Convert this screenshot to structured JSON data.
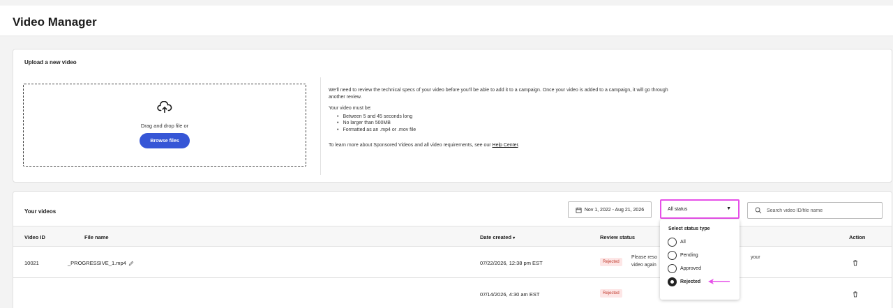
{
  "header": {
    "title": "Video Manager"
  },
  "upload": {
    "title": "Upload a new video",
    "drop_text": "Drag and drop file or",
    "browse_label": "Browse files",
    "info_intro": "We'll need to review the technical specs of your video before you'll be able to add it to a campaign. Once your video is added to a campaign, it will go through another review.",
    "requirements_heading": "Your video must be:",
    "requirements": [
      "Between 5 and 45 seconds long",
      "No larger than 500MB",
      "Formatted as an .mp4 or .mov file"
    ],
    "learn_more_prefix": "To learn more about Sponsored Videos and all video requirements, see our ",
    "help_link": "Help Center",
    "learn_more_suffix": "."
  },
  "videos": {
    "title": "Your videos",
    "date_range": "Nov 1, 2022 - Aug 21, 2026",
    "status_value": "All status",
    "search_placeholder": "Search video ID/file name",
    "columns": {
      "video_id": "Video ID",
      "file_name": "File name",
      "date_created": "Date created",
      "review_status": "Review status",
      "action": "Action"
    },
    "sort_indicator": "▾",
    "rows": [
      {
        "video_id": "10021",
        "file_name": "_PROGRESSIVE_1.mp4",
        "date_created": "07/22/2026, 12:38 pm EST",
        "status": "Rejected",
        "message_line1": "Please reso",
        "message_line2": "video again",
        "message_tail": "your"
      },
      {
        "video_id": "",
        "file_name": "",
        "date_created": "07/14/2026, 4:30 am EST",
        "status": "Rejected"
      }
    ]
  },
  "status_dropdown": {
    "title": "Select status type",
    "options": [
      "All",
      "Pending",
      "Approved",
      "Rejected"
    ],
    "selected": "Rejected"
  },
  "colors": {
    "accent": "#3656d6",
    "highlight": "#e64fe8",
    "rejected_bg": "#fde6e6",
    "rejected_text": "#c0392b"
  },
  "icons": {
    "upload": "cloud-upload-icon",
    "calendar": "calendar-icon",
    "caret": "caret-down-icon",
    "search": "search-icon",
    "edit": "pencil-icon",
    "delete": "trash-icon",
    "annotation": "arrow-left-icon"
  }
}
